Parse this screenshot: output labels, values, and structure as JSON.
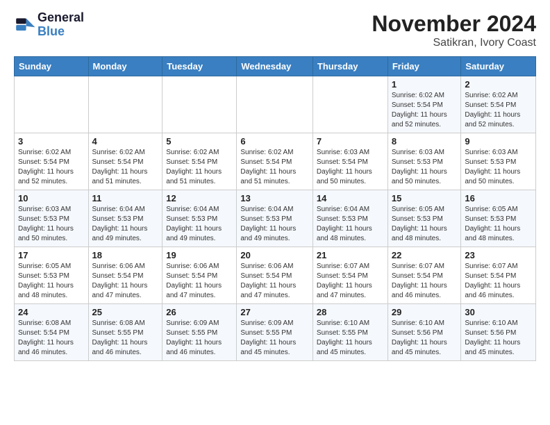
{
  "header": {
    "logo_line1": "General",
    "logo_line2": "Blue",
    "title": "November 2024",
    "subtitle": "Satikran, Ivory Coast"
  },
  "weekdays": [
    "Sunday",
    "Monday",
    "Tuesday",
    "Wednesday",
    "Thursday",
    "Friday",
    "Saturday"
  ],
  "weeks": [
    [
      {
        "day": "",
        "info": ""
      },
      {
        "day": "",
        "info": ""
      },
      {
        "day": "",
        "info": ""
      },
      {
        "day": "",
        "info": ""
      },
      {
        "day": "",
        "info": ""
      },
      {
        "day": "1",
        "info": "Sunrise: 6:02 AM\nSunset: 5:54 PM\nDaylight: 11 hours and 52 minutes."
      },
      {
        "day": "2",
        "info": "Sunrise: 6:02 AM\nSunset: 5:54 PM\nDaylight: 11 hours and 52 minutes."
      }
    ],
    [
      {
        "day": "3",
        "info": "Sunrise: 6:02 AM\nSunset: 5:54 PM\nDaylight: 11 hours and 52 minutes."
      },
      {
        "day": "4",
        "info": "Sunrise: 6:02 AM\nSunset: 5:54 PM\nDaylight: 11 hours and 51 minutes."
      },
      {
        "day": "5",
        "info": "Sunrise: 6:02 AM\nSunset: 5:54 PM\nDaylight: 11 hours and 51 minutes."
      },
      {
        "day": "6",
        "info": "Sunrise: 6:02 AM\nSunset: 5:54 PM\nDaylight: 11 hours and 51 minutes."
      },
      {
        "day": "7",
        "info": "Sunrise: 6:03 AM\nSunset: 5:54 PM\nDaylight: 11 hours and 50 minutes."
      },
      {
        "day": "8",
        "info": "Sunrise: 6:03 AM\nSunset: 5:53 PM\nDaylight: 11 hours and 50 minutes."
      },
      {
        "day": "9",
        "info": "Sunrise: 6:03 AM\nSunset: 5:53 PM\nDaylight: 11 hours and 50 minutes."
      }
    ],
    [
      {
        "day": "10",
        "info": "Sunrise: 6:03 AM\nSunset: 5:53 PM\nDaylight: 11 hours and 50 minutes."
      },
      {
        "day": "11",
        "info": "Sunrise: 6:04 AM\nSunset: 5:53 PM\nDaylight: 11 hours and 49 minutes."
      },
      {
        "day": "12",
        "info": "Sunrise: 6:04 AM\nSunset: 5:53 PM\nDaylight: 11 hours and 49 minutes."
      },
      {
        "day": "13",
        "info": "Sunrise: 6:04 AM\nSunset: 5:53 PM\nDaylight: 11 hours and 49 minutes."
      },
      {
        "day": "14",
        "info": "Sunrise: 6:04 AM\nSunset: 5:53 PM\nDaylight: 11 hours and 48 minutes."
      },
      {
        "day": "15",
        "info": "Sunrise: 6:05 AM\nSunset: 5:53 PM\nDaylight: 11 hours and 48 minutes."
      },
      {
        "day": "16",
        "info": "Sunrise: 6:05 AM\nSunset: 5:53 PM\nDaylight: 11 hours and 48 minutes."
      }
    ],
    [
      {
        "day": "17",
        "info": "Sunrise: 6:05 AM\nSunset: 5:53 PM\nDaylight: 11 hours and 48 minutes."
      },
      {
        "day": "18",
        "info": "Sunrise: 6:06 AM\nSunset: 5:54 PM\nDaylight: 11 hours and 47 minutes."
      },
      {
        "day": "19",
        "info": "Sunrise: 6:06 AM\nSunset: 5:54 PM\nDaylight: 11 hours and 47 minutes."
      },
      {
        "day": "20",
        "info": "Sunrise: 6:06 AM\nSunset: 5:54 PM\nDaylight: 11 hours and 47 minutes."
      },
      {
        "day": "21",
        "info": "Sunrise: 6:07 AM\nSunset: 5:54 PM\nDaylight: 11 hours and 47 minutes."
      },
      {
        "day": "22",
        "info": "Sunrise: 6:07 AM\nSunset: 5:54 PM\nDaylight: 11 hours and 46 minutes."
      },
      {
        "day": "23",
        "info": "Sunrise: 6:07 AM\nSunset: 5:54 PM\nDaylight: 11 hours and 46 minutes."
      }
    ],
    [
      {
        "day": "24",
        "info": "Sunrise: 6:08 AM\nSunset: 5:54 PM\nDaylight: 11 hours and 46 minutes."
      },
      {
        "day": "25",
        "info": "Sunrise: 6:08 AM\nSunset: 5:55 PM\nDaylight: 11 hours and 46 minutes."
      },
      {
        "day": "26",
        "info": "Sunrise: 6:09 AM\nSunset: 5:55 PM\nDaylight: 11 hours and 46 minutes."
      },
      {
        "day": "27",
        "info": "Sunrise: 6:09 AM\nSunset: 5:55 PM\nDaylight: 11 hours and 45 minutes."
      },
      {
        "day": "28",
        "info": "Sunrise: 6:10 AM\nSunset: 5:55 PM\nDaylight: 11 hours and 45 minutes."
      },
      {
        "day": "29",
        "info": "Sunrise: 6:10 AM\nSunset: 5:56 PM\nDaylight: 11 hours and 45 minutes."
      },
      {
        "day": "30",
        "info": "Sunrise: 6:10 AM\nSunset: 5:56 PM\nDaylight: 11 hours and 45 minutes."
      }
    ]
  ]
}
